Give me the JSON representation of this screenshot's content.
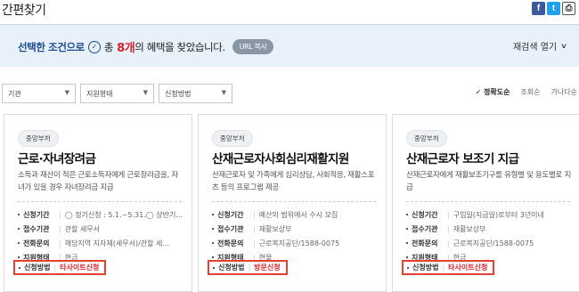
{
  "header": {
    "title": "간편찾기"
  },
  "share": {
    "facebook": "f",
    "twitter": "t",
    "print": "⎙"
  },
  "banner": {
    "lead": "선택한 조건으로",
    "check_glyph": "✓",
    "mid": "총",
    "count": "8개",
    "tail": "의 혜택을 찾았습니다.",
    "url_button": "URL 복사",
    "research": "재검색 열기",
    "research_chevron": "∨"
  },
  "filters": [
    {
      "label": "기관",
      "arrow": "▼"
    },
    {
      "label": "지원형태",
      "arrow": "▼"
    },
    {
      "label": "신청방법",
      "arrow": "▼"
    }
  ],
  "sort": {
    "accuracy": "✓ 정확도순",
    "views": "조회순",
    "alpha": "가나다순"
  },
  "cards": [
    {
      "badge": "중앙부처",
      "title": "근로·자녀장려금",
      "desc": "소득과 재산이 적은 근로소득자에게 근로장려금을, 자녀가 있을 경우 자녀장려금 지급",
      "rows": [
        {
          "label": "신청기간",
          "value": "◯ 정기신청 : 5.1.~5.31.◯ 상반기..."
        },
        {
          "label": "접수기관",
          "value": "관할 세무서"
        },
        {
          "label": "전화문의",
          "value": "해당지역 지자체(세무서)/관할 세..."
        },
        {
          "label": "지원형태",
          "value": "현금"
        }
      ],
      "method_label": "신청방법",
      "method_value": "타사이트신청"
    },
    {
      "badge": "중앙부처",
      "title": "산재근로자사회심리재활지원",
      "desc": "산재근로자 및 가족에게 심리상담, 사회적응, 재활스포츠 등의 프로그램 제공",
      "rows": [
        {
          "label": "신청기간",
          "value": "예산의 범위에서 수시 모집"
        },
        {
          "label": "접수기관",
          "value": "재활보상부"
        },
        {
          "label": "전화문의",
          "value": "근로복지공단/1588-0075"
        },
        {
          "label": "지원형태",
          "value": "현물"
        }
      ],
      "method_label": "신청방법",
      "method_value": "방문신청"
    },
    {
      "badge": "중앙부처",
      "title": "산재근로자 보조기 지급",
      "desc": "산재근로자에게 재활보조기구를 유형별 및 용도별로 지급",
      "rows": [
        {
          "label": "신청기간",
          "value": "구입일(지급일)로부터 3년이내"
        },
        {
          "label": "접수기관",
          "value": "재활보상부"
        },
        {
          "label": "전화문의",
          "value": "근로복지공단/1588-0075"
        },
        {
          "label": "지원형태",
          "value": "현금"
        }
      ],
      "method_label": "신청방법",
      "method_value": "타사이트신청"
    }
  ]
}
